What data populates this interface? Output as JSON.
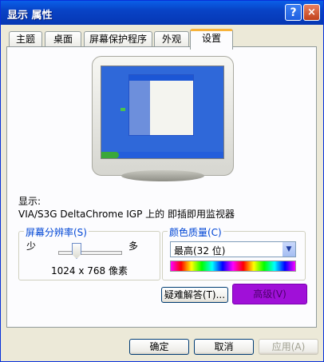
{
  "window": {
    "title": "显示 属性",
    "help_label": "?",
    "close_label": "×"
  },
  "tabs": [
    {
      "label": "主题"
    },
    {
      "label": "桌面"
    },
    {
      "label": "屏幕保护程序"
    },
    {
      "label": "外观"
    },
    {
      "label": "设置"
    }
  ],
  "display": {
    "label": "显示:",
    "device": "VIA/S3G DeltaChrome IGP 上的 即插即用监视器"
  },
  "resolution": {
    "group_label": "屏幕分辨率(S)",
    "min_label": "少",
    "max_label": "多",
    "value_text": "1024 x 768 像素",
    "slider_fraction": 0.3
  },
  "color_quality": {
    "group_label": "颜色质量(C)",
    "selected": "最高(32 位)"
  },
  "buttons": {
    "troubleshoot": "疑难解答(T)...",
    "advanced": "高级(V)",
    "ok": "确定",
    "cancel": "取消",
    "apply": "应用(A)"
  },
  "colors": {
    "title_bar": "#0a5fe8",
    "advanced_highlight": "#a010d8",
    "group_label": "#0046d5"
  }
}
